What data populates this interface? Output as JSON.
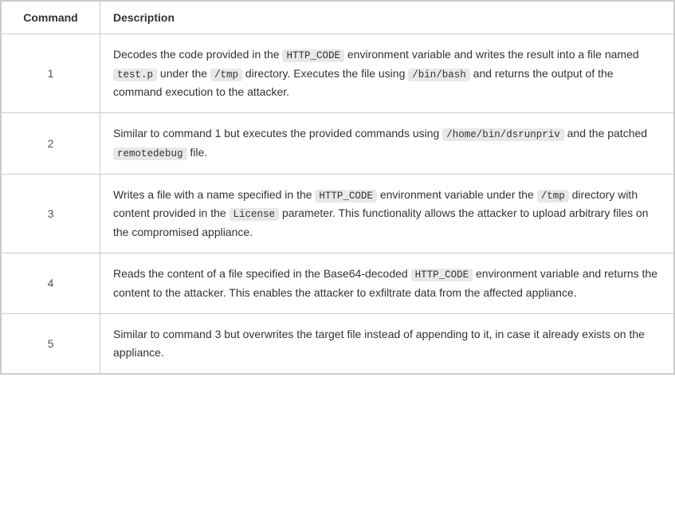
{
  "table": {
    "headers": {
      "command": "Command",
      "description": "Description"
    },
    "rows": [
      {
        "id": 1,
        "description_parts": [
          {
            "type": "text",
            "value": "Decodes the code provided in the "
          },
          {
            "type": "code",
            "value": "HTTP_CODE"
          },
          {
            "type": "text",
            "value": " environment variable and writes the result into a file named "
          },
          {
            "type": "code",
            "value": "test.p"
          },
          {
            "type": "text",
            "value": " under the "
          },
          {
            "type": "code",
            "value": "/tmp"
          },
          {
            "type": "text",
            "value": " directory. Executes the file using "
          },
          {
            "type": "code",
            "value": "/bin/bash"
          },
          {
            "type": "text",
            "value": " and returns the output of the command execution to the attacker."
          }
        ]
      },
      {
        "id": 2,
        "description_parts": [
          {
            "type": "text",
            "value": "Similar to command 1 but executes the provided commands using "
          },
          {
            "type": "code",
            "value": "/home/bin/dsrunpriv"
          },
          {
            "type": "text",
            "value": " and the patched "
          },
          {
            "type": "code",
            "value": "remotedebug"
          },
          {
            "type": "text",
            "value": " file."
          }
        ]
      },
      {
        "id": 3,
        "description_parts": [
          {
            "type": "text",
            "value": "Writes a file with a name specified in the "
          },
          {
            "type": "code",
            "value": "HTTP_CODE"
          },
          {
            "type": "text",
            "value": " environment variable under the "
          },
          {
            "type": "code",
            "value": "/tmp"
          },
          {
            "type": "text",
            "value": " directory with content provided in the "
          },
          {
            "type": "code",
            "value": "License"
          },
          {
            "type": "text",
            "value": " parameter. This functionality allows the attacker to upload arbitrary files on the compromised appliance."
          }
        ]
      },
      {
        "id": 4,
        "description_parts": [
          {
            "type": "text",
            "value": "Reads the content of a file specified in the Base64-decoded "
          },
          {
            "type": "code",
            "value": "HTTP_CODE"
          },
          {
            "type": "text",
            "value": " environment variable and returns the content to the attacker. This enables the attacker to exfiltrate data from the affected appliance."
          }
        ]
      },
      {
        "id": 5,
        "description_parts": [
          {
            "type": "text",
            "value": "Similar to command 3 but overwrites the target file instead of appending to it, in case it already exists on the appliance."
          }
        ]
      }
    ]
  }
}
